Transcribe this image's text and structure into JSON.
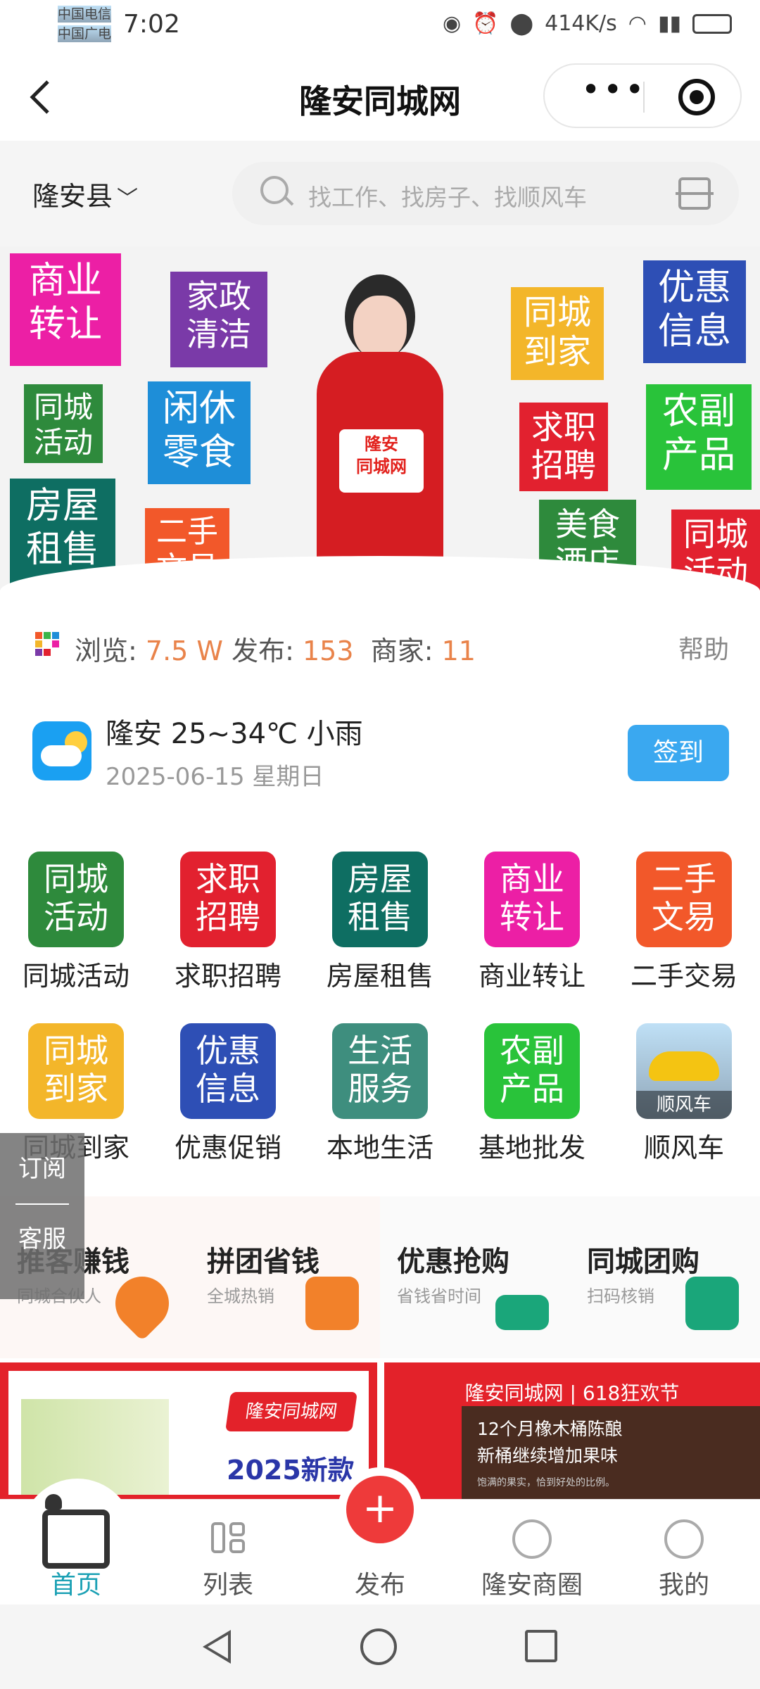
{
  "status_bar": {
    "carrier1": "中国电信",
    "carrier2": "中国广电",
    "time": "7:02",
    "speed": "414K/s"
  },
  "nav": {
    "back_icon": "chevron-left-icon",
    "title": "隆安同城网"
  },
  "search": {
    "location": "隆安县",
    "placeholder": "找工作、找房子、找顺风车"
  },
  "banner": {
    "tiles": [
      {
        "text": "商业\n转让",
        "color": "#ec1fa5"
      },
      {
        "text": "家政\n清洁",
        "color": "#7a3aa8"
      },
      {
        "text": "同城\n活动",
        "color": "#2e8a3c"
      },
      {
        "text": "闲休\n零食",
        "color": "#1e8ed8"
      },
      {
        "text": "房屋\n租售",
        "color": "#0e6e62"
      },
      {
        "text": "二手\n文易",
        "color": "#f2582a"
      },
      {
        "text": "同城\n到家",
        "color": "#f3b62a"
      },
      {
        "text": "优惠\n信息",
        "color": "#2e4fb5"
      },
      {
        "text": "求职\n招聘",
        "color": "#e2212f"
      },
      {
        "text": "农副\n产品",
        "color": "#29c33a"
      },
      {
        "text": "美食\n酒店",
        "color": "#2e8a3c"
      },
      {
        "text": "同城\n活动",
        "color": "#e2212f"
      }
    ],
    "card_text": "隆安\n同城网"
  },
  "stats": {
    "browse_label": "浏览:",
    "browse_value": "7.5 W",
    "publish_label": "发布:",
    "publish_value": "153",
    "merchant_label": "商家:",
    "merchant_value": "11",
    "help": "帮助"
  },
  "weather": {
    "summary": "隆安 25~34℃ 小雨",
    "date": "2025-06-15 星期日",
    "sign_button": "签到"
  },
  "categories": [
    {
      "icon_text": "同城\n活动",
      "label": "同城活动",
      "color": "#2e8a3c"
    },
    {
      "icon_text": "求职\n招聘",
      "label": "求职招聘",
      "color": "#e2212f"
    },
    {
      "icon_text": "房屋\n租售",
      "label": "房屋租售",
      "color": "#0e6e62"
    },
    {
      "icon_text": "商业\n转让",
      "label": "商业转让",
      "color": "#ec1fa5"
    },
    {
      "icon_text": "二手\n文易",
      "label": "二手交易",
      "color": "#f2582a"
    },
    {
      "icon_text": "同城\n到家",
      "label": "同城到家",
      "color": "#f3b62a"
    },
    {
      "icon_text": "优惠\n信息",
      "label": "优惠促销",
      "color": "#2e4fb5"
    },
    {
      "icon_text": "生活\n服务",
      "label": "本地生活",
      "color": "#3e8e7e"
    },
    {
      "icon_text": "农副\n产品",
      "label": "基地批发",
      "color": "#29c33a"
    },
    {
      "icon_text": "顺风车",
      "label": "顺风车",
      "color": "#f4c412"
    }
  ],
  "side_tab": {
    "subscribe": "订阅",
    "service": "客服"
  },
  "promos": [
    {
      "title": "推客赚钱",
      "subtitle": "同城合伙人",
      "color": "#f2812a"
    },
    {
      "title": "拼团省钱",
      "subtitle": "全城热销",
      "color": "#f2812a"
    },
    {
      "title": "优惠抢购",
      "subtitle": "省钱省时间",
      "color": "#1aa67a"
    },
    {
      "title": "同城团购",
      "subtitle": "扫码核销",
      "color": "#1aa67a"
    }
  ],
  "ads": {
    "ad1_badge": "隆安同城网",
    "ad1_title": "2025新款",
    "ad2_header": "隆安同城网 | 618狂欢节",
    "ad2_line1": "12个月橡木桶陈酿",
    "ad2_line2": "新桶继续增加果味",
    "ad2_small": "饱满的果实，恰到好处的比例。"
  },
  "tabbar": [
    {
      "label": "首页",
      "active": true
    },
    {
      "label": "列表"
    },
    {
      "label": "发布"
    },
    {
      "label": "隆安商圈"
    },
    {
      "label": "我的"
    }
  ],
  "colors": {
    "accent": "#e9834a",
    "active_tab": "#1aa0b4",
    "sign": "#3aa8f0",
    "publish": "#ee3a3a"
  }
}
